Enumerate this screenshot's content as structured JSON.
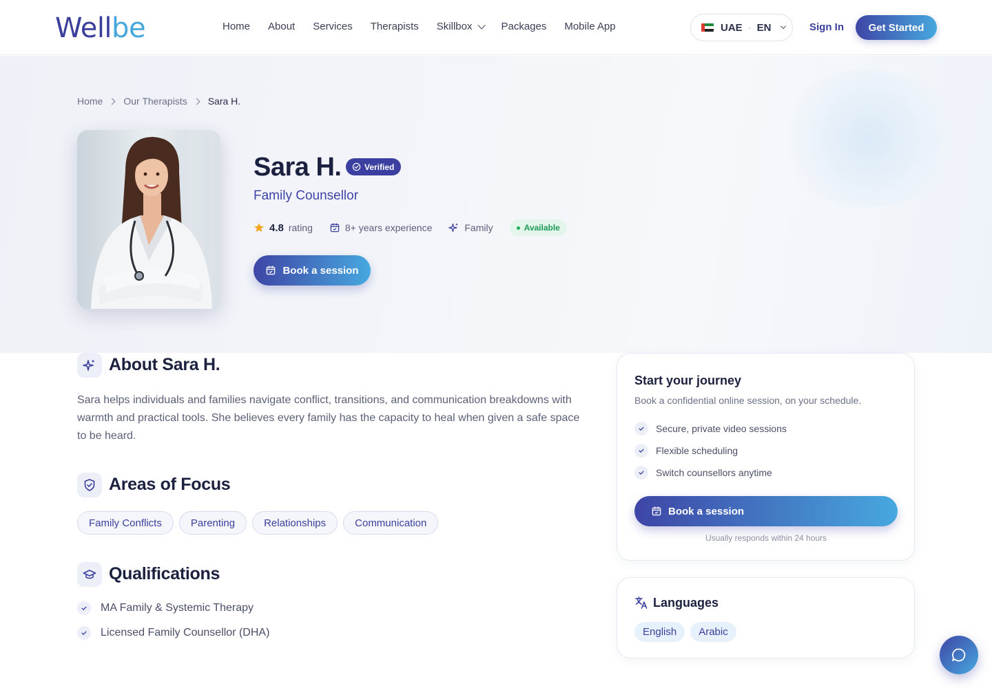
{
  "header": {
    "logo_w": "Well",
    "logo_be": "be",
    "nav": [
      "Home",
      "About",
      "Services",
      "Therapists",
      "Skillbox",
      "Packages",
      "Mobile App"
    ],
    "region": "UAE",
    "language": "EN",
    "sign_in": "Sign In",
    "get_started": "Get Started"
  },
  "breadcrumb": [
    "Home",
    "Our Therapists",
    "Sara H."
  ],
  "profile": {
    "name": "Sara H.",
    "verified": "Verified",
    "role": "Family Counsellor",
    "rating": "4.8",
    "rating_label": "rating",
    "experience": "8+ years experience",
    "specialty": "Family",
    "availability": "Available",
    "book": "Book a session"
  },
  "about": {
    "title": "About Sara H.",
    "text": "Sara helps individuals and families navigate conflict, transitions, and communication breakdowns with warmth and practical tools. She believes every family has the capacity to heal when given a safe space to be heard."
  },
  "focus": {
    "title": "Areas of Focus",
    "tags": [
      "Family Conflicts",
      "Parenting",
      "Relationships",
      "Communication"
    ]
  },
  "qualifications": {
    "title": "Qualifications",
    "items": [
      "MA Family & Systemic Therapy",
      "Licensed Family Counsellor (DHA)"
    ]
  },
  "journey": {
    "title": "Start your journey",
    "subtitle": "Book a confidential online session, on your schedule.",
    "features": [
      "Secure, private video sessions",
      "Flexible scheduling",
      "Switch counsellors anytime"
    ],
    "book": "Book a session",
    "note": "Usually responds within 24 hours"
  },
  "languages": {
    "title": "Languages",
    "items": [
      "English",
      "Arabic"
    ]
  },
  "colors": {
    "brand": "#3b3f9c",
    "accent": "#47a8df",
    "success": "#1c9a55",
    "star": "#f5a623"
  }
}
